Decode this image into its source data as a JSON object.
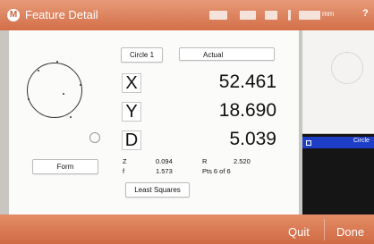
{
  "app": {
    "title": "Feature Detail",
    "logo_letter": "M",
    "unit_label": "mm",
    "help_label": "?"
  },
  "measure": {
    "feature_button": "Circle 1",
    "mode_button": "Actual",
    "x_label": "X",
    "x_value": "52.461",
    "y_label": "Y",
    "y_value": "18.690",
    "d_label": "D",
    "d_value": "5.039",
    "z_label": "Z",
    "z_value": "0.094",
    "r_label": "R",
    "r_value": "2.520",
    "f_label": "f",
    "f_value": "1.573",
    "pts_text": "Pts 6 of 6",
    "fit_button": "Least Squares",
    "form_button": "Form"
  },
  "side_panel": {
    "selected_label": "Circle"
  },
  "footer": {
    "quit_label": "Quit",
    "done_label": "Done"
  }
}
